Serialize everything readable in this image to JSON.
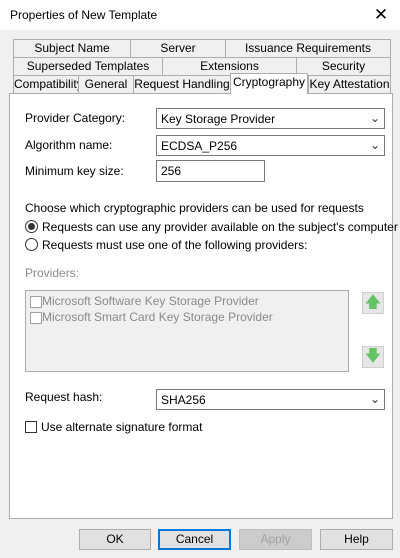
{
  "window": {
    "title": "Properties of New Template",
    "close_glyph": "✕"
  },
  "tabs": {
    "row1": [
      "Subject Name",
      "Server",
      "Issuance Requirements"
    ],
    "row2": [
      "Superseded Templates",
      "Extensions",
      "Security"
    ],
    "row3": [
      "Compatibility",
      "General",
      "Request Handling",
      "Cryptography",
      "Key Attestation"
    ],
    "active": "Cryptography"
  },
  "cryptography": {
    "provider_category_label": "Provider Category:",
    "provider_category_value": "Key Storage Provider",
    "algorithm_label": "Algorithm name:",
    "algorithm_value": "ECDSA_P256",
    "min_key_label": "Minimum key size:",
    "min_key_value": "256",
    "choose_text": "Choose which cryptographic providers can be used for requests",
    "radio_any": "Requests can use any provider available on the subject's computer",
    "radio_must": "Requests must use one of the following providers:",
    "radio_selected": "any",
    "providers_label": "Providers:",
    "providers": [
      {
        "label": "Microsoft Software Key Storage Provider",
        "checked": false
      },
      {
        "label": "Microsoft Smart Card Key Storage Provider",
        "checked": false
      }
    ],
    "request_hash_label": "Request hash:",
    "request_hash_value": "SHA256",
    "alt_sig_label": "Use alternate signature format",
    "alt_sig_checked": false,
    "dropdown_glyph": "⌄",
    "up_glyph": "🡅",
    "down_glyph": "🡇"
  },
  "buttons": {
    "ok": "OK",
    "cancel": "Cancel",
    "apply": "Apply",
    "help": "Help"
  },
  "colors": {
    "accent": "#0078d7",
    "arrow_green": "#62c462"
  }
}
